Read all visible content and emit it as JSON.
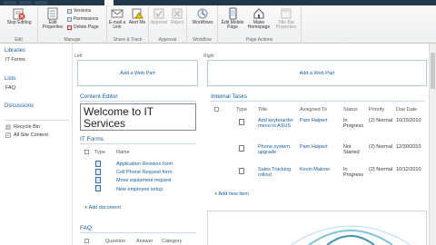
{
  "ribbon": {
    "stop_editing": "Stop Editing",
    "edit_properties": "Edit Properties",
    "versions": "Versions",
    "permissions": "Permissions",
    "delete_page": "Delete Page",
    "email_link": "E-mail a Link",
    "alert_me": "Alert Me",
    "approve": "Approve",
    "reject": "Reject",
    "workflows": "Workflows",
    "edit_mobile": "Edit Mobile Page",
    "make_homepage": "Make Homepage",
    "title_bar": "Title Bar Properties",
    "groups": [
      "Edit",
      "Manage",
      "Share & Track",
      "Approval",
      "Workflow",
      "Page Actions"
    ]
  },
  "nav": {
    "libraries": "Libraries",
    "it_forms": "IT Forms",
    "lists": "Lists",
    "faq": "FAQ",
    "discussions": "Discussions",
    "recycle_bin": "Recycle Bin",
    "all_content": "All Site Content"
  },
  "zones": {
    "left": "Left",
    "right": "Right"
  },
  "add_web_part": "Add a Web Part",
  "content_editor": {
    "title": "Content Editor",
    "text": "Welcome to IT Services"
  },
  "it_forms": {
    "title": "IT Forms",
    "headers": [
      "Type",
      "Name"
    ],
    "items": [
      "Application Revision form",
      "Cell Phone Request form",
      "Move equipment request",
      "New employee setup"
    ],
    "add": "Add document"
  },
  "faq": {
    "title": "FAQ",
    "headers": [
      "Question",
      "Answer",
      "Category"
    ]
  },
  "tasks": {
    "title": "Internal Tasks",
    "headers": [
      "Type",
      "Title",
      "Assigned To",
      "Status",
      "Priority",
      "Due Date"
    ],
    "rows": [
      {
        "title": "Add keyboarder menu to ASUS",
        "assigned": "Pam Halpert",
        "status": "In Progress",
        "priority": "(2) Normal",
        "due": "10/15/2010"
      },
      {
        "title": "Phone system upgrade",
        "assigned": "Pam Halpert",
        "status": "Not Started",
        "priority": "(2) Normal",
        "due": "12/30/2010"
      },
      {
        "title": "Sales Tracking rollout",
        "assigned": "Kevin Malone",
        "status": "In Progress",
        "priority": "(2) Normal",
        "due": "10/12/2010"
      }
    ],
    "add": "Add new item"
  }
}
